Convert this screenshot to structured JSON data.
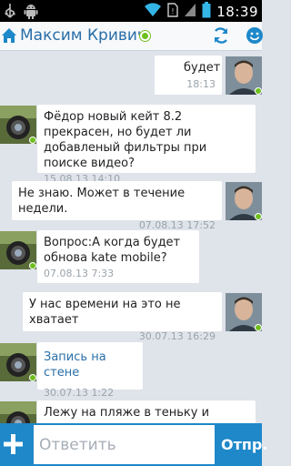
{
  "status_bar": {
    "clock": "18:39",
    "icons": [
      "usb-icon",
      "android-icon",
      "wifi-icon",
      "no-sim-icon",
      "signal-icon",
      "battery-icon"
    ]
  },
  "header": {
    "title": "Максим Кривич",
    "online": true,
    "accent_color": "#2a6fa8",
    "online_color": "#6fbf1e"
  },
  "messages": [
    {
      "direction": "out",
      "text": "будет",
      "time": "18:13",
      "avatar": "user-photo-maxim"
    },
    {
      "direction": "in",
      "text": "Фёдор новый кейт 8.2 прекрасен, но будет ли добавленый фильтры при поиске видео?",
      "time": "15.08.13 14:10",
      "avatar": "user-photo-camera"
    },
    {
      "direction": "out",
      "text": "Не знаю. Может в течение недели.",
      "time": "07.08.13 17:52",
      "avatar": "user-photo-maxim"
    },
    {
      "direction": "in",
      "text": "Вопрос:А когда будет обнова kate mobile?",
      "time": "07.08.13 7:33",
      "avatar": "user-photo-camera"
    },
    {
      "direction": "out",
      "text": "У нас времени на это не хватает",
      "time": "30.07.13 16:29",
      "avatar": "user-photo-maxim"
    },
    {
      "direction": "in",
      "text": "Запись на стене",
      "time": "30.07.13 1:22",
      "avatar": "user-photo-camera",
      "is_link": true
    },
    {
      "direction": "in",
      "text": "Лежу на пляже в теньку и читаю",
      "time": "",
      "avatar": "user-photo-camera"
    }
  ],
  "composer": {
    "placeholder": "Ответить",
    "send_label": "Отпр.",
    "bar_color": "#1e88c9"
  }
}
